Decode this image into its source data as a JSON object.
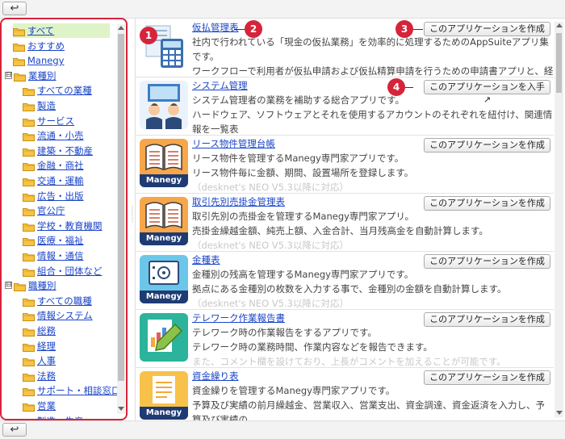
{
  "toolbar": {
    "back_icon": "↩"
  },
  "sidebar": {
    "items": [
      {
        "label": "すべて",
        "selected": true
      },
      {
        "label": "おすすめ"
      },
      {
        "label": "Manegy"
      },
      {
        "label": "業種別",
        "toggle": "⊟"
      },
      {
        "label": "すべての業種"
      },
      {
        "label": "製造"
      },
      {
        "label": "サービス"
      },
      {
        "label": "流通・小売"
      },
      {
        "label": "建築・不動産"
      },
      {
        "label": "金融・商社"
      },
      {
        "label": "交通・運輸"
      },
      {
        "label": "広告・出版"
      },
      {
        "label": "官公庁"
      },
      {
        "label": "学校・教育機関"
      },
      {
        "label": "医療・福祉"
      },
      {
        "label": "情報・通信"
      },
      {
        "label": "組合・団体など"
      },
      {
        "label": "職種別",
        "toggle": "⊟"
      },
      {
        "label": "すべての職種"
      },
      {
        "label": "情報システム"
      },
      {
        "label": "総務"
      },
      {
        "label": "経理"
      },
      {
        "label": "人事"
      },
      {
        "label": "法務"
      },
      {
        "label": "サポート・相談窓口"
      },
      {
        "label": "営業"
      },
      {
        "label": "製造・生産"
      }
    ]
  },
  "apps": [
    {
      "title": "仮払管理表",
      "button": "このアプリケーションを作成",
      "icon": "calculator-icon",
      "lines": [
        "社内で行われている「現金の仮払業務」を効率的に処理するためのAppSuiteアプリ集です。",
        "ワークフローで利用者が仮払申請および仮払精算申請を行うための申請書アプリと、経理担当者が"
      ],
      "faded": "仮払金の支払・精算状況の確認・管理を行う「仮払管理表」アプリで構成されています。"
    },
    {
      "title": "システム管理",
      "button": "このアプリケーションを入手",
      "button_icon": "↗",
      "icon": "system-admin-icon",
      "lines": [
        "システム管理者の業務を補助する総合アプリです。",
        "ハードウェア、ソフトウェアとそれを使用するアカウントのそれぞれを紐付け、関連情報を一覧表"
      ],
      "faded": "示できます。"
    },
    {
      "title": "リース物件管理台帳",
      "button": "このアプリケーションを作成",
      "icon": "manegy-book-icon",
      "lines": [
        "リース物件を管理するManegy専門家アプリです。",
        "リース物件毎に金額、期間、設置場所を登録します。"
      ],
      "faded": "（desknet's NEO V5.3以降に対応）"
    },
    {
      "title": "取引先別売掛金管理表",
      "button": "このアプリケーションを作成",
      "icon": "manegy-book-icon",
      "lines": [
        "取引先別の売掛金を管理するManegy専門家アプリ。",
        "売掛金繰越金額、純売上額、入金合計、当月残高金を自動計算します。"
      ],
      "faded": "（desknet's NEO V5.3以降に対応）"
    },
    {
      "title": "金種表",
      "button": "このアプリケーションを作成",
      "icon": "manegy-safe-icon",
      "lines": [
        "金種別の残高を管理するManegy専門家アプリです。",
        "拠点にある金種別の枚数を入力する事で、金種別の金額を自動計算します。"
      ],
      "faded": "（desknet's NEO V5.3以降に対応）"
    },
    {
      "title": "テレワーク作業報告書",
      "button": "このアプリケーションを作成",
      "icon": "report-pencil-icon",
      "lines": [
        "テレワーク時の作業報告をするアプリです。",
        "テレワーク時の業務時間、作業内容などを報告できます。"
      ],
      "faded": "また、コメント欄を設けており、上長がコメントを加えることが可能です。"
    },
    {
      "title": "資金繰り表",
      "button": "このアプリケーションを作成",
      "icon": "manegy-doc-icon",
      "lines": [
        "資金繰りを管理するManegy専門家アプリです。",
        "予算及び実績の前月繰越金、営業収入、営業支出、資金調達、資金返済を入力し、予算及び実績の"
      ],
      "faded": ""
    }
  ],
  "manegy_label": "Manegy",
  "callouts": [
    "1",
    "2",
    "3",
    "4"
  ],
  "colors": {
    "accent_red": "#d6243a",
    "link": "#1a44c8",
    "selected_bg": "#dff3c8"
  }
}
